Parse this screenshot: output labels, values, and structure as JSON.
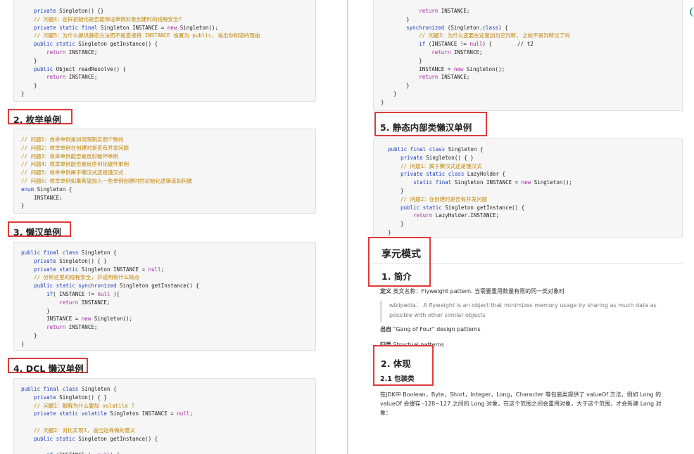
{
  "left": {
    "code_top": [
      {
        "t": "    private Singleton() {}",
        "c": "plain"
      },
      {
        "t": "    // 问题4：这样初始化是否能保证单例对象创建时的线程安全?",
        "c": "cm"
      },
      {
        "t": "    private static final Singleton INSTANCE = new Singleton();",
        "c": "plain"
      },
      {
        "t": "    // 问题5：为什么提供静态方法而不是直接将 INSTANCE 设置为 public, 说出你知道的理由",
        "c": "cm"
      },
      {
        "t": "    public static Singleton getInstance() {",
        "c": "plain"
      },
      {
        "t": "        return INSTANCE;",
        "c": "plain"
      },
      {
        "t": "    }",
        "c": "plain"
      },
      {
        "t": "    public Object readResolve() {",
        "c": "plain"
      },
      {
        "t": "        return INSTANCE;",
        "c": "plain"
      },
      {
        "t": "    }",
        "c": "plain"
      },
      {
        "t": "}",
        "c": "plain"
      }
    ],
    "h_enum": "2. 枚举单例",
    "code_enum": [
      {
        "t": "// 问题1：枚举单例是如何限制实例个数的",
        "c": "cm"
      },
      {
        "t": "// 问题2：枚举单例在创建时是否有并发问题",
        "c": "cm"
      },
      {
        "t": "// 问题3：枚举单例能否被反射破坏单例",
        "c": "cm"
      },
      {
        "t": "// 问题4：枚举单例能否被反序列化破坏单例",
        "c": "cm"
      },
      {
        "t": "// 问题5：枚举单例属于懒汉式还是饿汉式",
        "c": "cm"
      },
      {
        "t": "// 问题6：枚举单例如果希望加入一些单例创建时的初始化逻辑该如何做",
        "c": "cm"
      },
      {
        "t": "enum Singleton {",
        "c": "plain"
      },
      {
        "t": "    INSTANCE;",
        "c": "plain"
      },
      {
        "t": "}",
        "c": "plain"
      }
    ],
    "h_lazy": "3. 懒汉单例",
    "code_lazy": [
      {
        "t": "public final class Singleton {",
        "c": "plain"
      },
      {
        "t": "    private Singleton() { }",
        "c": "plain"
      },
      {
        "t": "    private static Singleton INSTANCE = null;",
        "c": "plain"
      },
      {
        "t": "    // 分析这里的线程安全, 并说明有什么缺点",
        "c": "cm"
      },
      {
        "t": "    public static synchronized Singleton getInstance() {",
        "c": "plain"
      },
      {
        "t": "        if( INSTANCE != null ){",
        "c": "plain"
      },
      {
        "t": "            return INSTANCE;",
        "c": "plain"
      },
      {
        "t": "        }",
        "c": "plain"
      },
      {
        "t": "        INSTANCE = new Singleton();",
        "c": "plain"
      },
      {
        "t": "        return INSTANCE;",
        "c": "plain"
      },
      {
        "t": "    }",
        "c": "plain"
      },
      {
        "t": "}",
        "c": "plain"
      }
    ],
    "h_dcl": "4. DCL 懒汉单例",
    "code_dcl": [
      {
        "t": "public final class Singleton {",
        "c": "plain"
      },
      {
        "t": "    private Singleton() { }",
        "c": "plain"
      },
      {
        "t": "    // 问题1：解释为什么要加 volatile ?",
        "c": "cm"
      },
      {
        "t": "    private static volatile Singleton INSTANCE = null;",
        "c": "plain"
      },
      {
        "t": "",
        "c": "plain"
      },
      {
        "t": "    // 问题2：对比实现3, 说出这样做的意义",
        "c": "cm"
      },
      {
        "t": "    public static Singleton getInstance() {",
        "c": "plain"
      },
      {
        "t": "",
        "c": "plain"
      },
      {
        "t": "        if (INSTANCE != null) {",
        "c": "plain"
      }
    ]
  },
  "right": {
    "code_top": [
      {
        "t": "            return INSTANCE;",
        "c": "plain"
      },
      {
        "t": "        }",
        "c": "plain"
      },
      {
        "t": "        synchronized (Singleton.class) {",
        "c": "plain"
      },
      {
        "t": "            // 问题3：为什么还要在这里加为空判断, 之前不是判断过了吗",
        "c": "cm"
      },
      {
        "t": "            if (INSTANCE != null) {        // t2",
        "c": "plain"
      },
      {
        "t": "                return INSTANCE;",
        "c": "plain"
      },
      {
        "t": "            }",
        "c": "plain"
      },
      {
        "t": "            INSTANCE = new Singleton();",
        "c": "plain"
      },
      {
        "t": "            return INSTANCE;",
        "c": "plain"
      },
      {
        "t": "        }",
        "c": "plain"
      },
      {
        "t": "    }",
        "c": "plain"
      },
      {
        "t": "}",
        "c": "plain"
      }
    ],
    "h_static": "5. 静态内部类懒汉单例",
    "code_static": [
      {
        "t": "public final class Singleton {",
        "c": "plain"
      },
      {
        "t": "    private Singleton() { }",
        "c": "plain"
      },
      {
        "t": "    // 问题1：属于懒汉式还是饿汉式",
        "c": "cm"
      },
      {
        "t": "    private static class LazyHolder {",
        "c": "plain"
      },
      {
        "t": "        static final Singleton INSTANCE = new Singleton();",
        "c": "plain"
      },
      {
        "t": "    }",
        "c": "plain"
      },
      {
        "t": "    // 问题2：在创建时是否有并发问题",
        "c": "cm"
      },
      {
        "t": "    public static Singleton getInstance() {",
        "c": "plain"
      },
      {
        "t": "        return LazyHolder.INSTANCE;",
        "c": "plain"
      },
      {
        "t": "    }",
        "c": "plain"
      },
      {
        "t": "}",
        "c": "plain"
      }
    ],
    "h_flyweight": "享元模式",
    "h_intro": "1. 简介",
    "def_label": "定义",
    "def_text": " 英文名称：Flyweight pattern. 当需要重用数量有限的同一类对象时",
    "quote_line1": "wikipedia： A flyweight is an object that minimizes memory usage by sharing as much data as",
    "quote_line2": "possible with other similar objects",
    "src_label": "出自",
    "src_text": " \"Gang of Four\" design patterns",
    "cat_label": "归类",
    "cat_text": " Structual patterns",
    "h_embody": "2. 体现",
    "sub_wrap": "2.1 包装类",
    "para1": "在JDK中 Boolean，Byte，Short，Integer，Long，Character 等包装类提供了 valueOf 方法，例如 Long 的",
    "para2": "valueOf 会缓存 -128~127 之间的 Long 对象，在这个范围之间会重用对象，大于这个范围，才会新建 Long 对",
    "para3": "象："
  },
  "colors": {
    "highlight_border": "#e03a3a",
    "code_bg": "#f6f6f6",
    "comment": "#c18401",
    "keyword": "#a626a4"
  }
}
